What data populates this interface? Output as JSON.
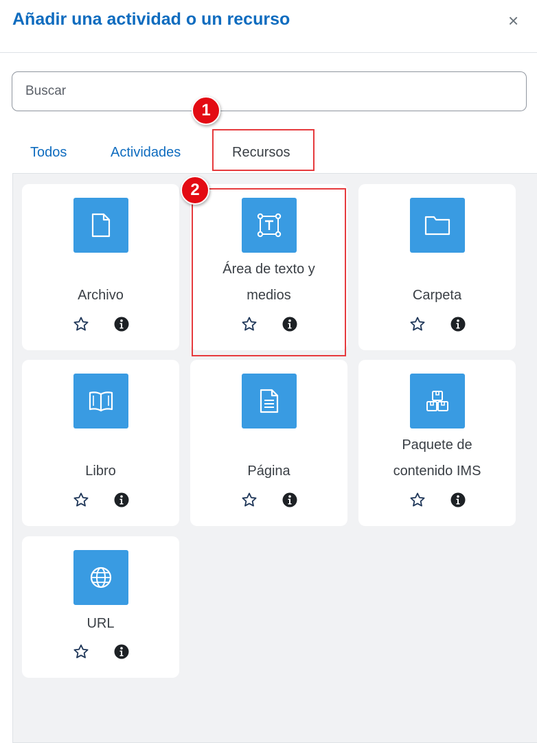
{
  "dialog": {
    "title": "Añadir una actividad o un recurso",
    "close_glyph": "×"
  },
  "search": {
    "placeholder": "Buscar",
    "value": ""
  },
  "tabs": [
    {
      "label": "Todos",
      "active": false
    },
    {
      "label": "Actividades",
      "active": false
    },
    {
      "label": "Recursos",
      "active": true
    }
  ],
  "items": [
    {
      "name": "Archivo",
      "icon": "file-icon"
    },
    {
      "name": "Área de texto y medios",
      "name_line1": "Área de texto y",
      "name_line2": "medios",
      "icon": "text-area-icon"
    },
    {
      "name": "Carpeta",
      "icon": "folder-icon"
    },
    {
      "name": "Libro",
      "icon": "book-icon"
    },
    {
      "name": "Página",
      "icon": "page-icon"
    },
    {
      "name": "Paquete de contenido IMS",
      "name_line1": "Paquete de",
      "name_line2": "contenido IMS",
      "icon": "ims-package-icon"
    },
    {
      "name": "URL",
      "icon": "globe-icon"
    }
  ],
  "annotations": [
    {
      "label": "1"
    },
    {
      "label": "2"
    }
  ],
  "colors": {
    "accent": "#0f6cbf",
    "icon_bg": "#399be2",
    "annotation_red": "#e30b13",
    "panel_bg": "#f1f2f4"
  }
}
